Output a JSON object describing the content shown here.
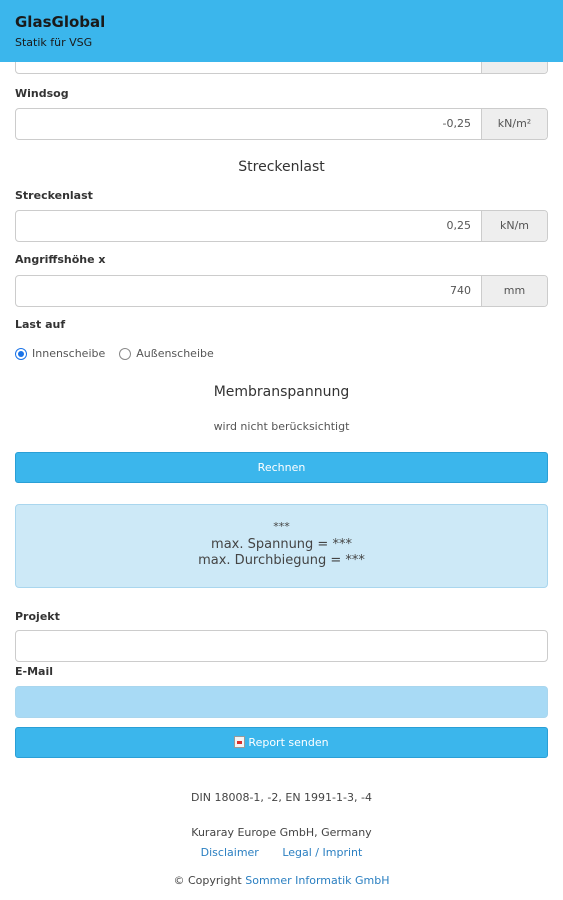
{
  "header": {
    "title": "GlasGlobal",
    "subtitle": "Statik für VSG"
  },
  "form": {
    "windsog": {
      "label": "Windsog",
      "value": "-0,25",
      "unit": "kN/m²"
    },
    "streckenlast_section": "Streckenlast",
    "streckenlast": {
      "label": "Streckenlast",
      "value": "0,25",
      "unit": "kN/m"
    },
    "angriffshoehe": {
      "label": "Angriffshöhe x",
      "value": "740",
      "unit": "mm"
    },
    "last_auf": {
      "label": "Last auf",
      "options": [
        "Innenscheibe",
        "Außenscheibe"
      ],
      "selected": "Innenscheibe"
    },
    "membran_section": "Membranspannung",
    "membran_note": "wird nicht berücksichtigt",
    "calculate_label": "Rechnen"
  },
  "result": {
    "stars": "***",
    "spannung": "max. Spannung = ***",
    "durchbiegung": "max. Durchbiegung = ***"
  },
  "report": {
    "projekt_label": "Projekt",
    "projekt_value": "",
    "email_label": "E-Mail",
    "email_value": "",
    "send_label": "Report senden"
  },
  "footer": {
    "norms": "DIN 18008-1, -2, EN 1991-1-3, -4",
    "company": "Kuraray Europe GmbH, Germany",
    "disclaimer": "Disclaimer",
    "imprint": "Legal / Imprint",
    "copyright_prefix": "© Copyright",
    "copyright_link": "Sommer Informatik GmbH"
  },
  "colors": {
    "accent": "#3bb6ec",
    "result_bg": "#cde9f7",
    "email_bg": "#a8daf5",
    "link": "#2a7fc1"
  }
}
